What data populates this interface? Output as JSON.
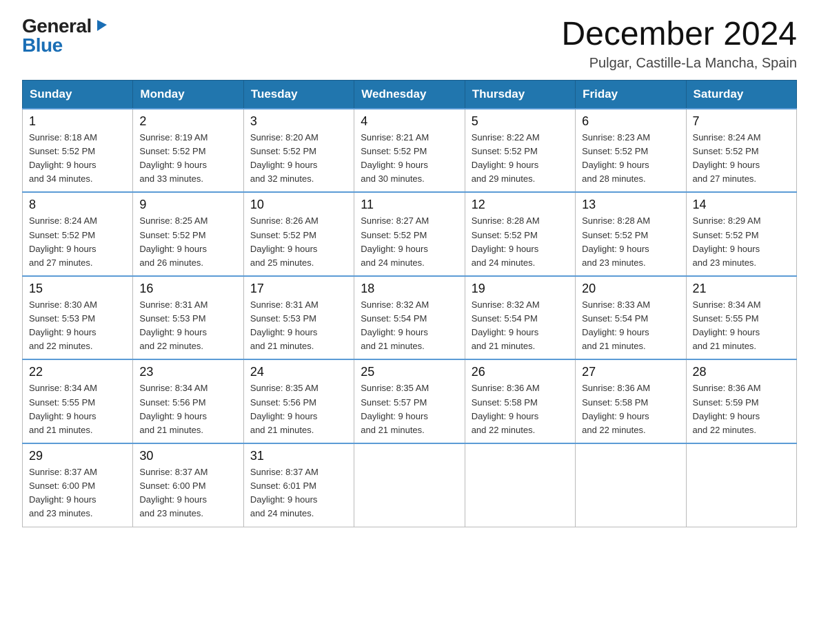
{
  "logo": {
    "general": "General",
    "triangle": "▶",
    "blue": "Blue"
  },
  "title": {
    "month_year": "December 2024",
    "location": "Pulgar, Castille-La Mancha, Spain"
  },
  "weekdays": [
    "Sunday",
    "Monday",
    "Tuesday",
    "Wednesday",
    "Thursday",
    "Friday",
    "Saturday"
  ],
  "weeks": [
    [
      {
        "day": "1",
        "sunrise": "8:18 AM",
        "sunset": "5:52 PM",
        "daylight": "9 hours and 34 minutes."
      },
      {
        "day": "2",
        "sunrise": "8:19 AM",
        "sunset": "5:52 PM",
        "daylight": "9 hours and 33 minutes."
      },
      {
        "day": "3",
        "sunrise": "8:20 AM",
        "sunset": "5:52 PM",
        "daylight": "9 hours and 32 minutes."
      },
      {
        "day": "4",
        "sunrise": "8:21 AM",
        "sunset": "5:52 PM",
        "daylight": "9 hours and 30 minutes."
      },
      {
        "day": "5",
        "sunrise": "8:22 AM",
        "sunset": "5:52 PM",
        "daylight": "9 hours and 29 minutes."
      },
      {
        "day": "6",
        "sunrise": "8:23 AM",
        "sunset": "5:52 PM",
        "daylight": "9 hours and 28 minutes."
      },
      {
        "day": "7",
        "sunrise": "8:24 AM",
        "sunset": "5:52 PM",
        "daylight": "9 hours and 27 minutes."
      }
    ],
    [
      {
        "day": "8",
        "sunrise": "8:24 AM",
        "sunset": "5:52 PM",
        "daylight": "9 hours and 27 minutes."
      },
      {
        "day": "9",
        "sunrise": "8:25 AM",
        "sunset": "5:52 PM",
        "daylight": "9 hours and 26 minutes."
      },
      {
        "day": "10",
        "sunrise": "8:26 AM",
        "sunset": "5:52 PM",
        "daylight": "9 hours and 25 minutes."
      },
      {
        "day": "11",
        "sunrise": "8:27 AM",
        "sunset": "5:52 PM",
        "daylight": "9 hours and 24 minutes."
      },
      {
        "day": "12",
        "sunrise": "8:28 AM",
        "sunset": "5:52 PM",
        "daylight": "9 hours and 24 minutes."
      },
      {
        "day": "13",
        "sunrise": "8:28 AM",
        "sunset": "5:52 PM",
        "daylight": "9 hours and 23 minutes."
      },
      {
        "day": "14",
        "sunrise": "8:29 AM",
        "sunset": "5:52 PM",
        "daylight": "9 hours and 23 minutes."
      }
    ],
    [
      {
        "day": "15",
        "sunrise": "8:30 AM",
        "sunset": "5:53 PM",
        "daylight": "9 hours and 22 minutes."
      },
      {
        "day": "16",
        "sunrise": "8:31 AM",
        "sunset": "5:53 PM",
        "daylight": "9 hours and 22 minutes."
      },
      {
        "day": "17",
        "sunrise": "8:31 AM",
        "sunset": "5:53 PM",
        "daylight": "9 hours and 21 minutes."
      },
      {
        "day": "18",
        "sunrise": "8:32 AM",
        "sunset": "5:54 PM",
        "daylight": "9 hours and 21 minutes."
      },
      {
        "day": "19",
        "sunrise": "8:32 AM",
        "sunset": "5:54 PM",
        "daylight": "9 hours and 21 minutes."
      },
      {
        "day": "20",
        "sunrise": "8:33 AM",
        "sunset": "5:54 PM",
        "daylight": "9 hours and 21 minutes."
      },
      {
        "day": "21",
        "sunrise": "8:34 AM",
        "sunset": "5:55 PM",
        "daylight": "9 hours and 21 minutes."
      }
    ],
    [
      {
        "day": "22",
        "sunrise": "8:34 AM",
        "sunset": "5:55 PM",
        "daylight": "9 hours and 21 minutes."
      },
      {
        "day": "23",
        "sunrise": "8:34 AM",
        "sunset": "5:56 PM",
        "daylight": "9 hours and 21 minutes."
      },
      {
        "day": "24",
        "sunrise": "8:35 AM",
        "sunset": "5:56 PM",
        "daylight": "9 hours and 21 minutes."
      },
      {
        "day": "25",
        "sunrise": "8:35 AM",
        "sunset": "5:57 PM",
        "daylight": "9 hours and 21 minutes."
      },
      {
        "day": "26",
        "sunrise": "8:36 AM",
        "sunset": "5:58 PM",
        "daylight": "9 hours and 22 minutes."
      },
      {
        "day": "27",
        "sunrise": "8:36 AM",
        "sunset": "5:58 PM",
        "daylight": "9 hours and 22 minutes."
      },
      {
        "day": "28",
        "sunrise": "8:36 AM",
        "sunset": "5:59 PM",
        "daylight": "9 hours and 22 minutes."
      }
    ],
    [
      {
        "day": "29",
        "sunrise": "8:37 AM",
        "sunset": "6:00 PM",
        "daylight": "9 hours and 23 minutes."
      },
      {
        "day": "30",
        "sunrise": "8:37 AM",
        "sunset": "6:00 PM",
        "daylight": "9 hours and 23 minutes."
      },
      {
        "day": "31",
        "sunrise": "8:37 AM",
        "sunset": "6:01 PM",
        "daylight": "9 hours and 24 minutes."
      },
      null,
      null,
      null,
      null
    ]
  ],
  "labels": {
    "sunrise": "Sunrise:",
    "sunset": "Sunset:",
    "daylight": "Daylight:"
  }
}
